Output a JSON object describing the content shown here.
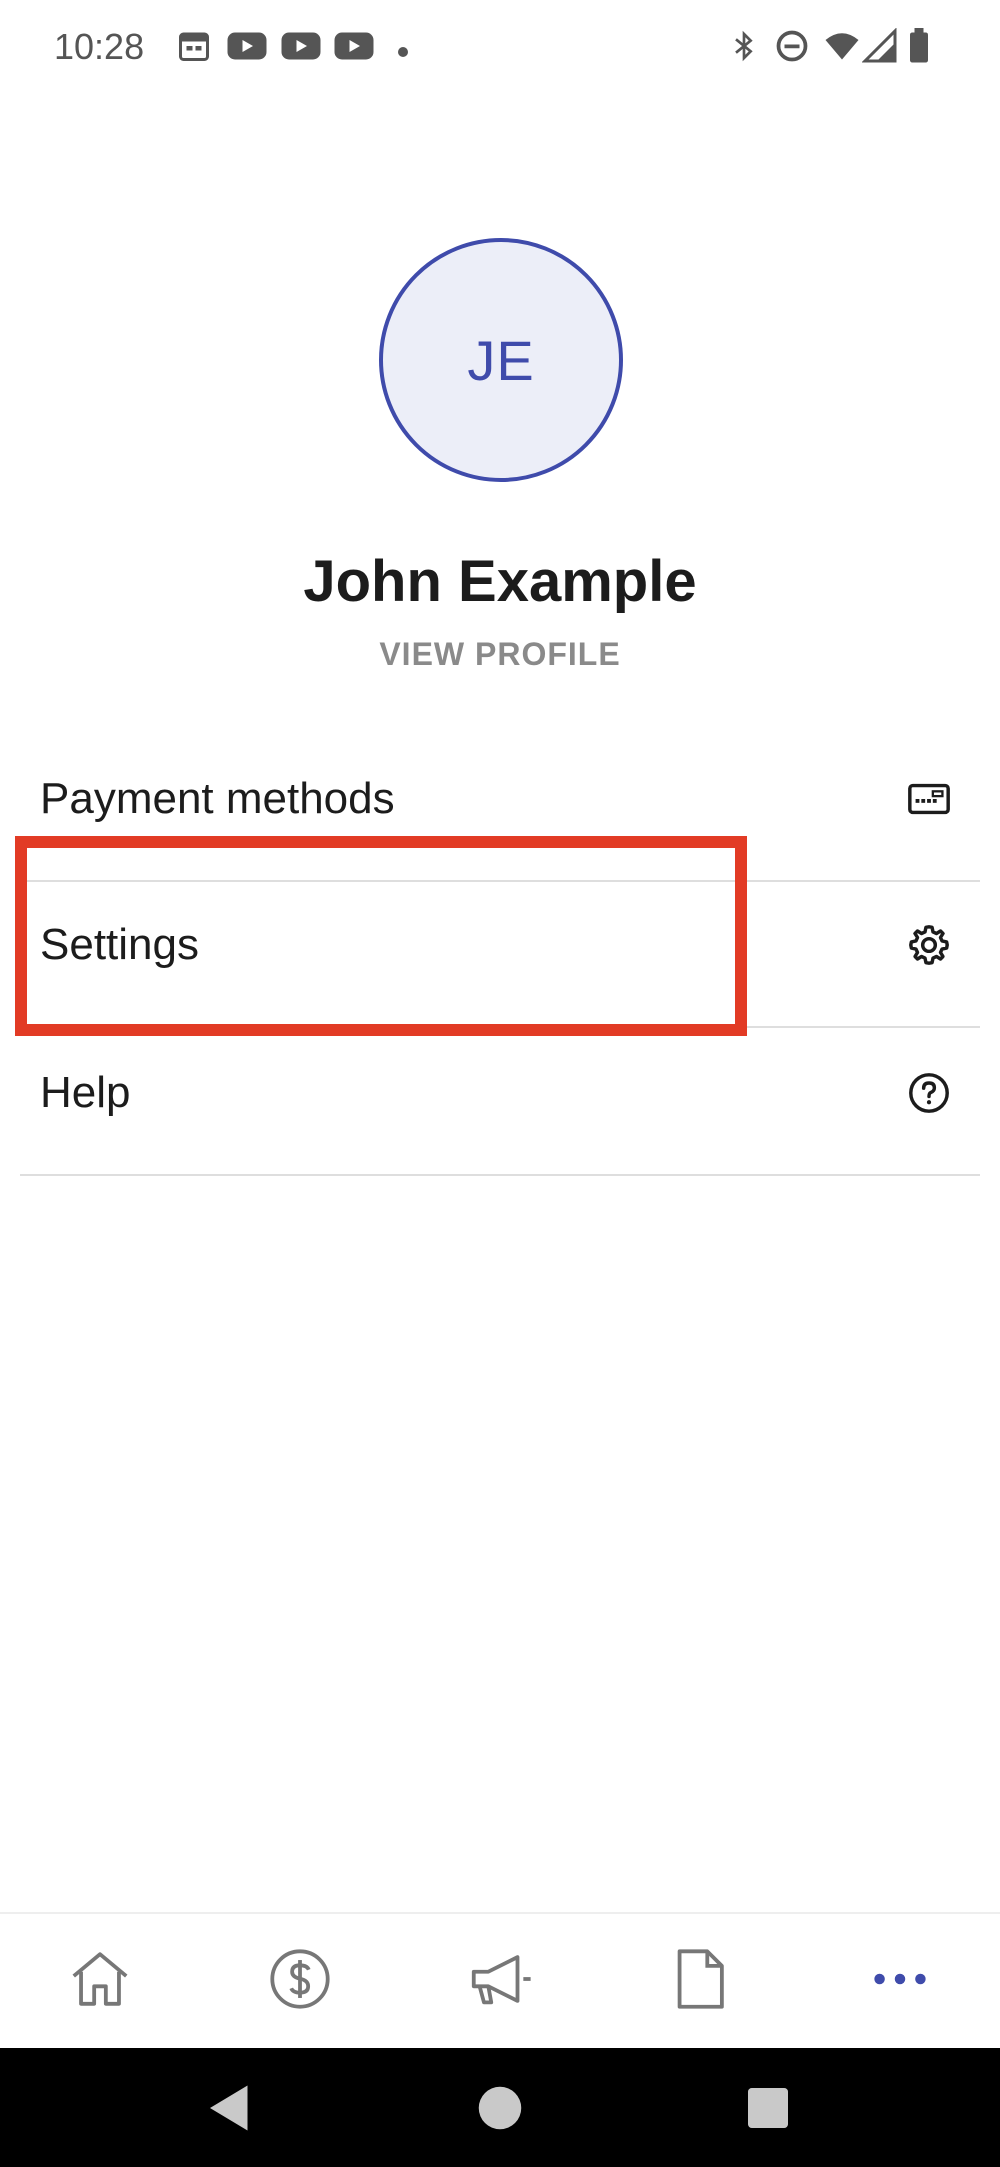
{
  "status_bar": {
    "time": "10:28"
  },
  "profile": {
    "initials": "JE",
    "name": "John Example",
    "view_profile": "VIEW PROFILE"
  },
  "menu": [
    {
      "label": "Payment methods",
      "icon": "payment-card-icon"
    },
    {
      "label": "Settings",
      "icon": "gear-icon"
    },
    {
      "label": "Help",
      "icon": "help-circle-icon"
    }
  ],
  "bottom_nav": [
    {
      "icon": "home-icon"
    },
    {
      "icon": "dollar-circle-icon"
    },
    {
      "icon": "megaphone-icon"
    },
    {
      "icon": "document-icon"
    },
    {
      "icon": "more-icon",
      "active": true
    }
  ],
  "colors": {
    "accent": "#3f4bab",
    "highlight": "#e23b25"
  }
}
